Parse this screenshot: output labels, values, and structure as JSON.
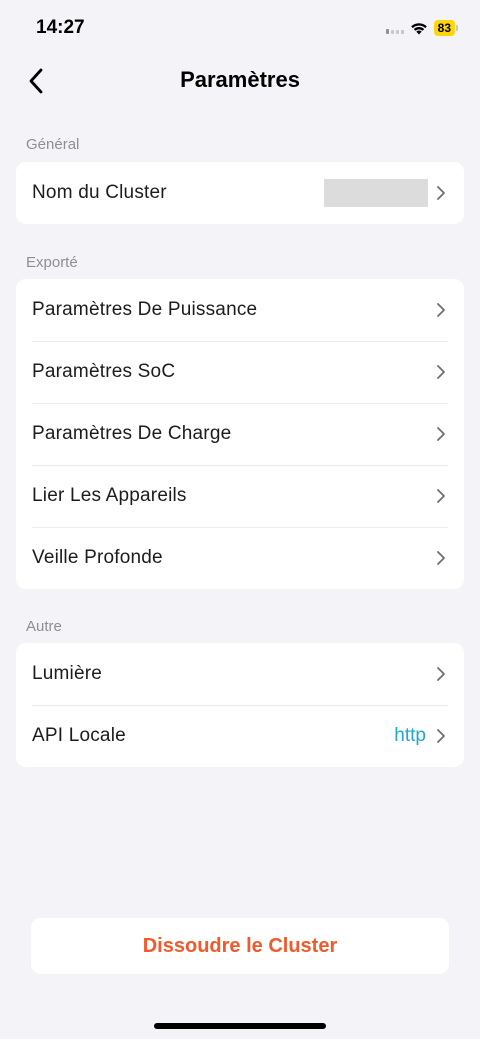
{
  "status_bar": {
    "time": "14:27",
    "battery_level": "83",
    "battery_color": "#ffd60a"
  },
  "nav": {
    "title": "Paramètres",
    "back_icon": "chevron-left-icon"
  },
  "sections": {
    "general": {
      "header": "Général",
      "items": [
        {
          "label": "Nom du Cluster",
          "value": ""
        }
      ]
    },
    "exported": {
      "header": "Exporté",
      "items": [
        {
          "label": "Paramètres De Puissance"
        },
        {
          "label": "Paramètres SoC"
        },
        {
          "label": "Paramètres De Charge"
        },
        {
          "label": "Lier Les Appareils"
        },
        {
          "label": "Veille Profonde"
        }
      ]
    },
    "other": {
      "header": "Autre",
      "items": [
        {
          "label": "Lumière"
        },
        {
          "label": "API Locale",
          "value": "http"
        }
      ]
    }
  },
  "actions": {
    "dissolve_label": "Dissoudre le Cluster",
    "dissolve_color": "#f15a2a"
  },
  "accent_color": "#1fa6d6"
}
